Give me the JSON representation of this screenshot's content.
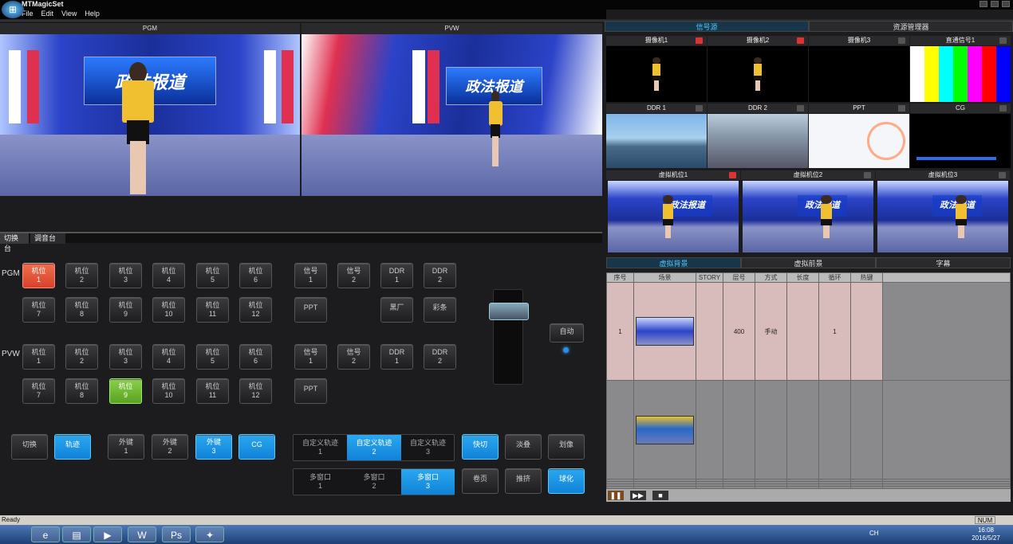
{
  "app": {
    "title": "MTMagicSet"
  },
  "menu": [
    "File",
    "Edit",
    "View",
    "Help"
  ],
  "monitors": {
    "pgm_label": "PGM",
    "pvw_label": "PVW",
    "pgm_logo": "政法报道",
    "pvw_logo": "政法报道"
  },
  "switcher": {
    "tabs": [
      "切换台",
      "调音台"
    ],
    "pgm_label": "PGM",
    "pvw_label": "PVW",
    "cam_prefix": "机位",
    "pgm_cams": [
      "1",
      "2",
      "3",
      "4",
      "5",
      "6",
      "7",
      "8",
      "9",
      "10",
      "11",
      "12"
    ],
    "pvw_cams": [
      "1",
      "2",
      "3",
      "4",
      "5",
      "6",
      "7",
      "8",
      "9",
      "10",
      "11",
      "12"
    ],
    "pgm_sources": [
      {
        "a": "信号",
        "b": "1"
      },
      {
        "a": "信号",
        "b": "2"
      },
      {
        "a": "DDR",
        "b": "1"
      },
      {
        "a": "DDR",
        "b": "2"
      }
    ],
    "pgm_sources2": [
      "PPT",
      "黑厂",
      "彩条"
    ],
    "pvw_sources": [
      {
        "a": "信号",
        "b": "1"
      },
      {
        "a": "信号",
        "b": "2"
      },
      {
        "a": "DDR",
        "b": "1"
      },
      {
        "a": "DDR",
        "b": "2"
      }
    ],
    "pvw_sources2": [
      "PPT"
    ],
    "auto": "自动",
    "bottom": {
      "cut": "切换",
      "track": "轨迹",
      "keys": [
        {
          "a": "外键",
          "b": "1"
        },
        {
          "a": "外键",
          "b": "2"
        },
        {
          "a": "外键",
          "b": "3"
        }
      ],
      "cg": "CG",
      "custom": [
        {
          "a": "自定义轨迹",
          "b": "1"
        },
        {
          "a": "自定义轨迹",
          "b": "2"
        },
        {
          "a": "自定义轨迹",
          "b": "3"
        }
      ],
      "fast_cut": "快切",
      "fade": "淡叠",
      "wipe": "划像",
      "multi": [
        {
          "a": "多窗口",
          "b": "1"
        },
        {
          "a": "多窗口",
          "b": "2"
        },
        {
          "a": "多窗口",
          "b": "3"
        }
      ],
      "page": "卷页",
      "push": "推挤",
      "ball": "球化"
    }
  },
  "right": {
    "tabs": [
      "信号源",
      "资源管理器"
    ],
    "row1": [
      "摄像机1",
      "摄像机2",
      "摄像机3",
      "直通信号1"
    ],
    "row2": [
      "DDR 1",
      "DDR 2",
      "PPT",
      "CG"
    ],
    "row3": [
      "虚拟机位1",
      "虚拟机位2",
      "虚拟机位3"
    ],
    "vs_logo": "政法报道",
    "bottom_tabs": [
      "虚拟背景",
      "虚拟前景",
      "字幕"
    ],
    "columns": [
      "序号",
      "场景",
      "STORY",
      "层号",
      "方式",
      "长度",
      "循环",
      "热键"
    ],
    "rows": [
      {
        "no": "1",
        "story": "",
        "layer": "400",
        "mode": "手动",
        "length": "",
        "loop": "1",
        "hotkey": ""
      }
    ]
  },
  "playbar": {
    "pause": "❚❚",
    "ff": "▶▶",
    "stop": "■"
  },
  "status": {
    "text": "Ready",
    "num": "NUM"
  },
  "taskbar": {
    "time": "16:08",
    "date": "2016/5/27",
    "tray": "CH"
  },
  "colors": {
    "red": "#d8412a",
    "green": "#5aa320",
    "blue": "#1182d8"
  }
}
